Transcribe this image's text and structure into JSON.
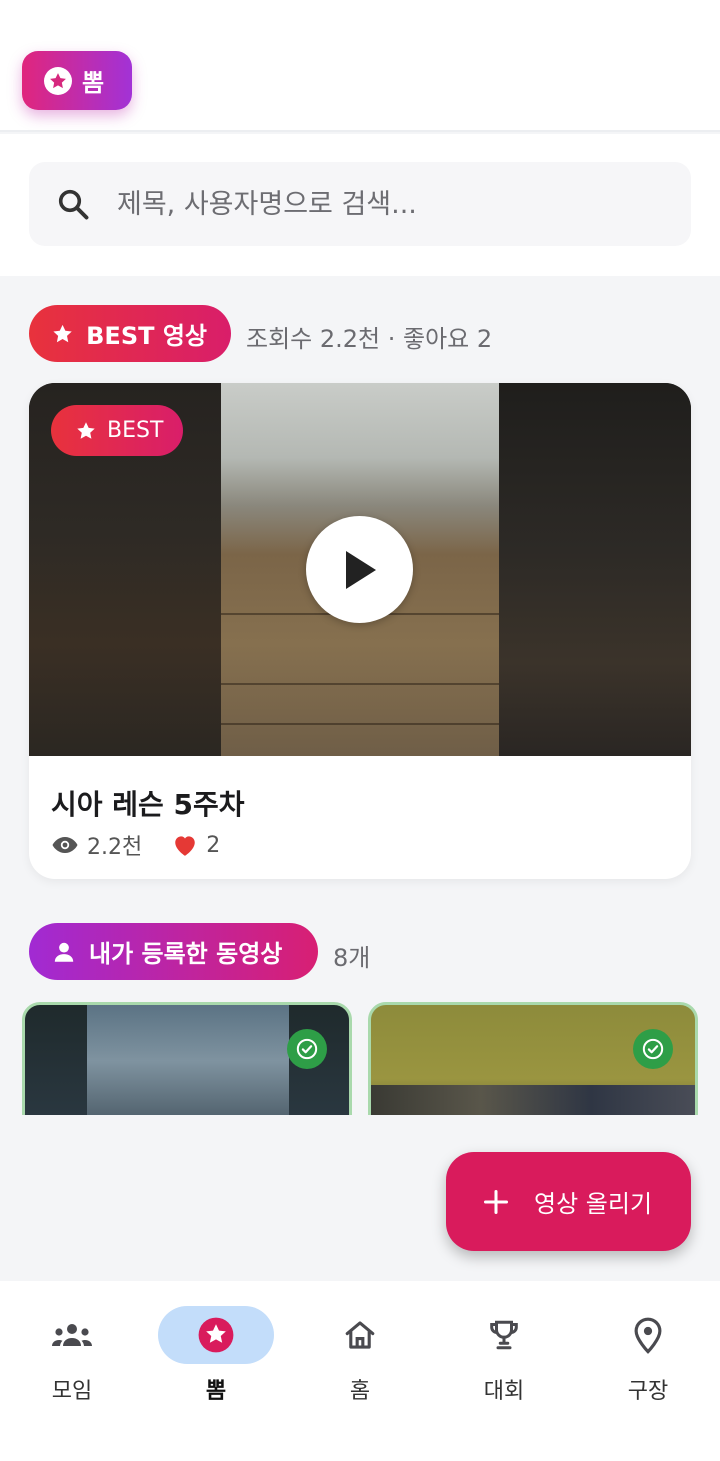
{
  "header": {
    "brand_label": "뽐"
  },
  "search": {
    "placeholder": "제목, 사용자명으로 검색..."
  },
  "best_section": {
    "badge_label": "BEST 영상",
    "meta": "조회수 2.2천 · 좋아요 2",
    "video": {
      "tag_label": "BEST",
      "title": "시아 레슨 5주차",
      "views": "2.2천",
      "likes": "2"
    }
  },
  "my_videos_section": {
    "badge_label": "내가 등록한 동영상",
    "count": "8개",
    "thumbnails": [
      {
        "status": "verified"
      },
      {
        "status": "verified"
      }
    ]
  },
  "fab": {
    "label": "영상 올리기"
  },
  "bottom_nav": {
    "items": [
      {
        "label": "모임",
        "icon": "group-icon"
      },
      {
        "label": "뽐",
        "icon": "star-circle-icon"
      },
      {
        "label": "홈",
        "icon": "home-icon"
      },
      {
        "label": "대회",
        "icon": "trophy-icon"
      },
      {
        "label": "구장",
        "icon": "location-pin-icon"
      }
    ],
    "active_index": 1
  },
  "colors": {
    "accent": "#d91b5c",
    "best_gradient_start": "#e8323c",
    "brand_gradient_end": "#a232d6",
    "active_nav_bg": "#c3ddfa",
    "verified_badge": "#2e9e47"
  }
}
